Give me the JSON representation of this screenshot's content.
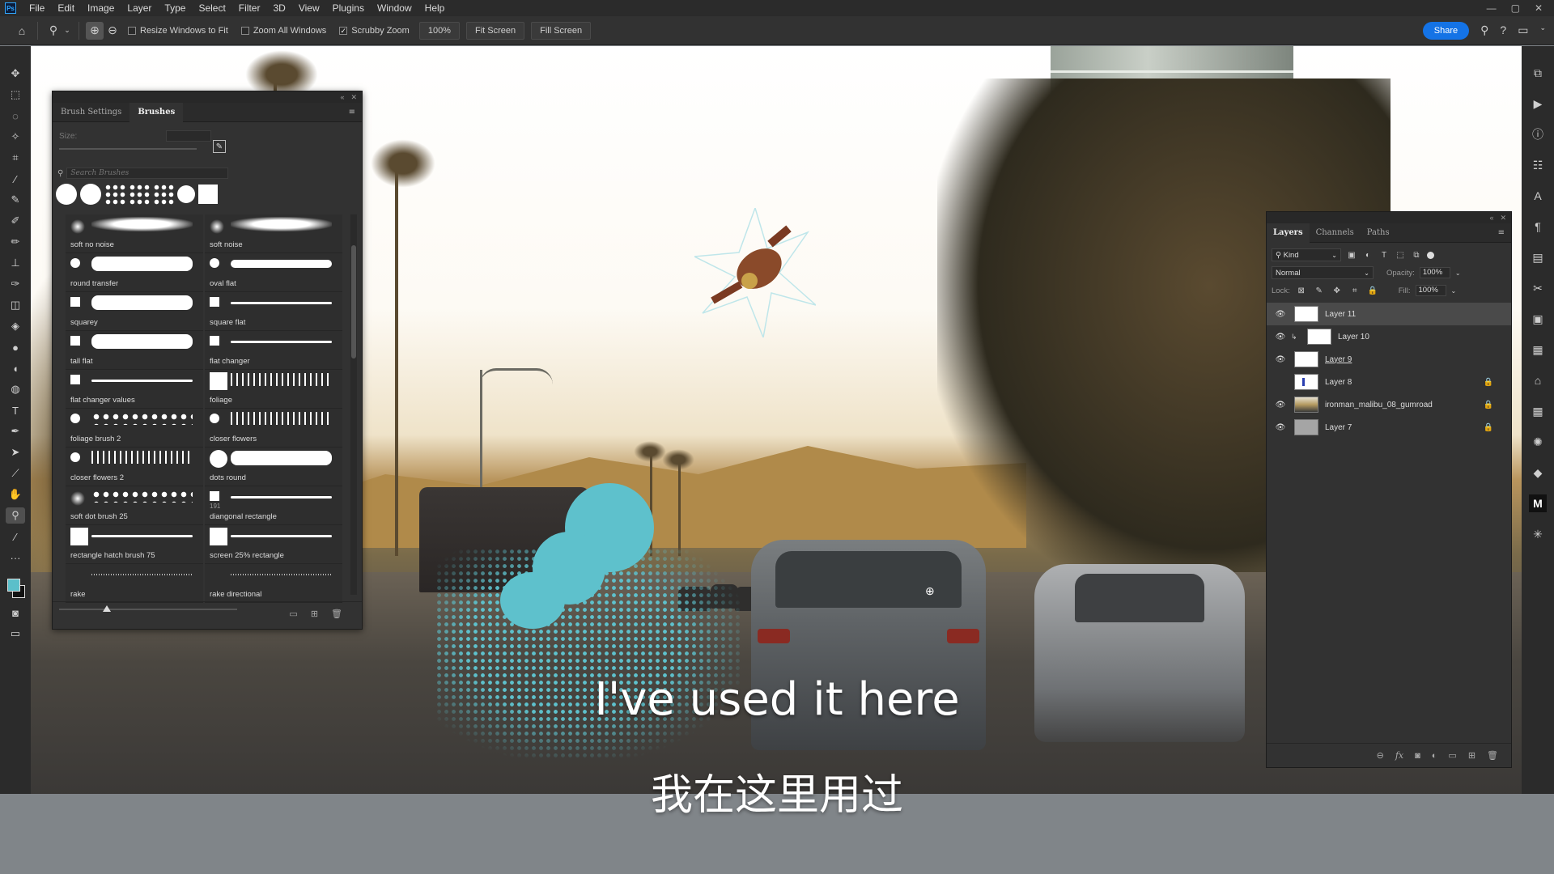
{
  "app": {
    "logo_text": "Ps",
    "menus": [
      "File",
      "Edit",
      "Image",
      "Layer",
      "Type",
      "Select",
      "Filter",
      "3D",
      "View",
      "Plugins",
      "Window",
      "Help"
    ],
    "window_controls": [
      "—",
      "▢",
      "✕"
    ]
  },
  "options_bar": {
    "resize_windows_label": "Resize Windows to Fit",
    "resize_windows_checked": false,
    "zoom_all_label": "Zoom All Windows",
    "zoom_all_checked": false,
    "scrubby_zoom_label": "Scrubby Zoom",
    "scrubby_zoom_checked": true,
    "zoom_value": "100%",
    "fit_screen_label": "Fit Screen",
    "fill_screen_label": "Fill Screen",
    "share_label": "Share"
  },
  "tools": [
    "move-tool",
    "marquee-tool",
    "lasso-tool",
    "magic-wand-tool",
    "crop-tool",
    "eyedropper-tool",
    "healing-brush-tool",
    "brush-tool",
    "pencil-tool",
    "clone-stamp-tool",
    "history-brush-tool",
    "eraser-tool",
    "paint-bucket-tool",
    "blur-tool",
    "dodge-tool",
    "pen-tool",
    "type-tool",
    "path-selection-tool",
    "line-tool",
    "hand-tool",
    "zoom-tool",
    "more-tools"
  ],
  "colors": {
    "foreground": "#5bbfca",
    "background": "#111111",
    "accent": "#1473e6"
  },
  "brush_panel": {
    "tabs": [
      "Brush Settings",
      "Brushes"
    ],
    "active_tab": "Brushes",
    "size_label": "Size:",
    "search_placeholder": "Search Brushes",
    "brushes": [
      {
        "name": "soft no noise",
        "thumb": "soft",
        "stroke": "soft"
      },
      {
        "name": "soft noise",
        "thumb": "soft",
        "stroke": "soft"
      },
      {
        "name": "round transfer",
        "thumb": "round",
        "stroke": "fat"
      },
      {
        "name": "oval flat",
        "thumb": "round",
        "stroke": "normal"
      },
      {
        "name": "squarey",
        "thumb": "square",
        "stroke": "fat"
      },
      {
        "name": "square flat",
        "thumb": "square",
        "stroke": "thin"
      },
      {
        "name": "tall flat",
        "thumb": "square",
        "stroke": "fat"
      },
      {
        "name": "flat changer",
        "thumb": "square",
        "stroke": "thin"
      },
      {
        "name": "flat changer values",
        "thumb": "square",
        "stroke": "thin"
      },
      {
        "name": "foliage",
        "thumb": "big",
        "stroke": "spiky"
      },
      {
        "name": "foliage brush 2",
        "thumb": "spiky",
        "stroke": "dots"
      },
      {
        "name": "closer flowers",
        "thumb": "spiky",
        "stroke": "spiky"
      },
      {
        "name": "closer flowers 2",
        "thumb": "spiky",
        "stroke": "spiky"
      },
      {
        "name": "dots round",
        "thumb": "big-round",
        "stroke": "fat"
      },
      {
        "name": "soft dot brush 25",
        "thumb": "soft",
        "stroke": "dots"
      },
      {
        "name": "diangonal rectangle",
        "thumb": "square",
        "stroke": "thin",
        "number": "191"
      },
      {
        "name": "rectangle hatch brush 75",
        "thumb": "big",
        "stroke": "thin"
      },
      {
        "name": "screen 25% rectangle",
        "thumb": "big",
        "stroke": "thin"
      },
      {
        "name": "rake",
        "thumb": "none",
        "stroke": "hatch"
      },
      {
        "name": "rake directional",
        "thumb": "none",
        "stroke": "hatch"
      }
    ]
  },
  "layers_panel": {
    "tabs": [
      "Layers",
      "Channels",
      "Paths"
    ],
    "active_tab": "Layers",
    "filter_kind": "Kind",
    "blend_mode": "Normal",
    "opacity_label": "Opacity:",
    "opacity_value": "100%",
    "lock_label": "Lock:",
    "fill_label": "Fill:",
    "fill_value": "100%",
    "layers": [
      {
        "name": "Layer 11",
        "visible": true,
        "selected": true,
        "thumb": "white",
        "locked": false,
        "clipped": false,
        "underline": false
      },
      {
        "name": "Layer 10",
        "visible": true,
        "selected": false,
        "thumb": "white",
        "locked": false,
        "clipped": true,
        "underline": false
      },
      {
        "name": "Layer 9",
        "visible": true,
        "selected": false,
        "thumb": "white",
        "locked": false,
        "clipped": false,
        "underline": true
      },
      {
        "name": "Layer 8",
        "visible": false,
        "selected": false,
        "thumb": "mark",
        "locked": true,
        "clipped": false,
        "underline": false
      },
      {
        "name": "ironman_malibu_08_gumroad",
        "visible": true,
        "selected": false,
        "thumb": "photo",
        "locked": true,
        "clipped": false,
        "underline": false
      },
      {
        "name": "Layer 7",
        "visible": true,
        "selected": false,
        "thumb": "gray",
        "locked": true,
        "clipped": false,
        "underline": false
      }
    ]
  },
  "subtitles": {
    "english": "I've used it here",
    "chinese": "我在这里用过"
  }
}
